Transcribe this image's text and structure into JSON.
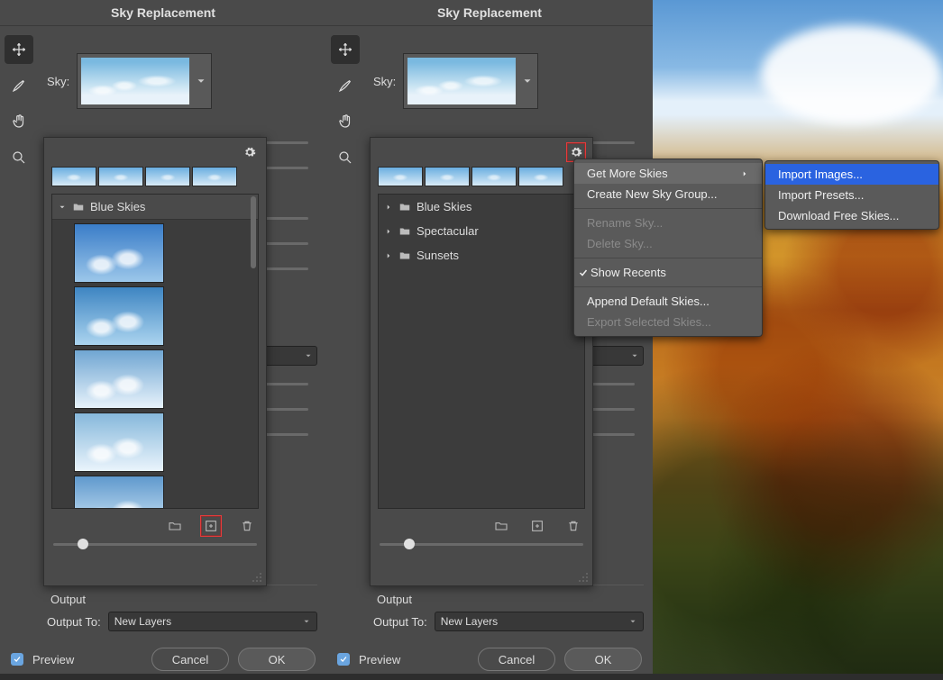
{
  "title": "Sky Replacement",
  "sky_label": "Sky:",
  "output": {
    "heading": "Output",
    "to_label": "Output To:",
    "to_value": "New Layers"
  },
  "preview_label": "Preview",
  "buttons": {
    "cancel": "Cancel",
    "ok": "OK"
  },
  "popover_left": {
    "folder_expanded": "Blue Skies"
  },
  "popover_right": {
    "folders": [
      "Blue Skies",
      "Spectacular",
      "Sunsets"
    ]
  },
  "menu": {
    "get_more": "Get More Skies",
    "create_group": "Create New Sky Group...",
    "rename": "Rename Sky...",
    "delete": "Delete Sky...",
    "show_recents": "Show Recents",
    "append_default": "Append Default Skies...",
    "export_selected": "Export Selected Skies..."
  },
  "submenu": {
    "import_images": "Import Images...",
    "import_presets": "Import Presets...",
    "download_free": "Download Free Skies..."
  }
}
